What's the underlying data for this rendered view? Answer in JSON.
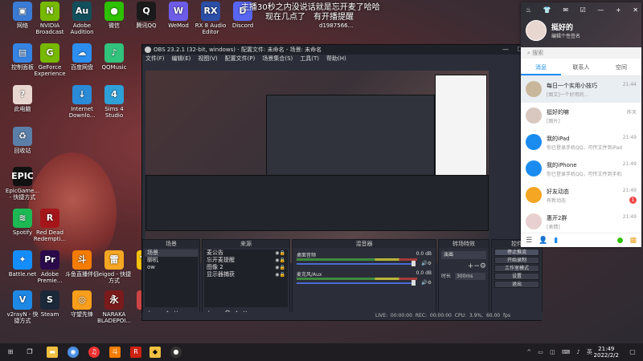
{
  "overlay": {
    "line1": "主播30秒之内没说话就是忘开麦了哈哈",
    "line2": "现在几点了",
    "line3": "有开播提醒",
    "line4": "d1987566..."
  },
  "desktop": [
    {
      "label": "网络",
      "icon": "network-icon",
      "color": "#3a7bd5",
      "glyph": "▣"
    },
    {
      "label": "NVIDIA Broadcast",
      "icon": "nvidia-icon",
      "color": "#76b900",
      "glyph": "N"
    },
    {
      "label": "Adobe Audition",
      "icon": "adobe-audition-icon",
      "color": "#124f5c",
      "glyph": "Au"
    },
    {
      "label": "微信",
      "icon": "wechat-icon",
      "color": "#2dc100",
      "glyph": "●"
    },
    {
      "label": "腾讯QQ",
      "icon": "qq-icon",
      "color": "#1a1a1a",
      "glyph": "Q"
    },
    {
      "label": "WeMod",
      "icon": "wemod-icon",
      "color": "#6c5ce7",
      "glyph": "W"
    },
    {
      "label": "RX 8 Audio Editor",
      "icon": "rx8-icon",
      "color": "#2b4fa8",
      "glyph": "RX"
    },
    {
      "label": "Discord",
      "icon": "discord-icon",
      "color": "#5865f2",
      "glyph": "D"
    },
    {
      "label": "控制面板",
      "icon": "control-panel-icon",
      "color": "#3584e4",
      "glyph": "▤"
    },
    {
      "label": "GeForce Experience",
      "icon": "geforce-icon",
      "color": "#76b900",
      "glyph": "G"
    },
    {
      "label": "百度网盘",
      "icon": "baidu-netdisk-icon",
      "color": "#2b8ef0",
      "glyph": "☁"
    },
    {
      "label": "QQMusic",
      "icon": "qqmusic-icon",
      "color": "#31c27c",
      "glyph": "♪"
    },
    {
      "label": "此电脑",
      "icon": "this-pc-icon",
      "color": "#e8d7d0",
      "glyph": "?"
    },
    {
      "label": "Internet Downlo...",
      "icon": "idm-icon",
      "color": "#2a8bd8",
      "glyph": "↓"
    },
    {
      "label": "Sims 4 Studio",
      "icon": "sims4-icon",
      "color": "#2ea0d8",
      "glyph": "4"
    },
    {
      "label": "回收站",
      "icon": "recycle-bin-icon",
      "color": "#5b7fa8",
      "glyph": "♻"
    },
    {
      "label": "EpicGame... - 快捷方式",
      "icon": "epic-games-icon",
      "color": "#111",
      "glyph": "EPIC"
    },
    {
      "label": "Spotify",
      "icon": "spotify-icon",
      "color": "#1db954",
      "glyph": "≋"
    },
    {
      "label": "Red Dead Redempti...",
      "icon": "rdr2-icon",
      "color": "#a4161a",
      "glyph": "R"
    },
    {
      "label": "Battle.net",
      "icon": "battlenet-icon",
      "color": "#148eff",
      "glyph": "✦"
    },
    {
      "label": "Adobe Premie...",
      "icon": "premiere-icon",
      "color": "#2a0a4a",
      "glyph": "Pr"
    },
    {
      "label": "斗鱼直播伴侣",
      "icon": "douyu-icon",
      "color": "#f57c00",
      "glyph": "斗"
    },
    {
      "label": "leigod - 快捷方式",
      "icon": "leigod-icon",
      "color": "#f5a623",
      "glyph": "雷"
    },
    {
      "label": "YY",
      "icon": "yy-icon",
      "color": "#f4c20d",
      "glyph": "YY"
    },
    {
      "label": "v2rayN - 快捷方式",
      "icon": "v2rayn-icon",
      "color": "#1e88e5",
      "glyph": "V"
    },
    {
      "label": "Steam",
      "icon": "steam-icon",
      "color": "#1b2838",
      "glyph": "S"
    },
    {
      "label": "守望先锋",
      "icon": "overwatch-icon",
      "color": "#f99e1a",
      "glyph": "◎"
    },
    {
      "label": "NARAKA BLADEPOI...",
      "icon": "naraka-icon",
      "color": "#7a1a1a",
      "glyph": "永"
    },
    {
      "label": "火...",
      "icon": "app-icon",
      "color": "#c44",
      "glyph": "火"
    }
  ],
  "obs": {
    "title": "OBS 23.2.1 (32-bit, windows) - 配置文件: 未命名 - 场景: 未命名",
    "menu": [
      "文件(F)",
      "编辑(E)",
      "视图(V)",
      "配置文件(P)",
      "场景集合(S)",
      "工具(T)",
      "帮助(H)"
    ],
    "docks": {
      "scenes": {
        "title": "场景",
        "items": [
          "场景",
          "聊机",
          "ow"
        ]
      },
      "sources": {
        "title": "来源",
        "items": [
          "麦公告",
          "忘开麦提醒",
          "图像 2",
          "显示器捕获"
        ]
      },
      "mixer": {
        "title": "混音器",
        "tracks": [
          {
            "name": "桌面音频",
            "db": "0.0 dB"
          },
          {
            "name": "麦克风/Aux",
            "db": "0.0 dB"
          }
        ]
      },
      "transitions": {
        "title": "转场特效",
        "type": "淡出",
        "duration_label": "时长",
        "duration": "300ms"
      },
      "controls": {
        "title": "控件",
        "buttons": [
          "停止推流",
          "开始录制",
          "工作室模式",
          "设置",
          "退出"
        ]
      }
    },
    "status": {
      "live": "LIVE: 00:00:00",
      "rec": "REC: 00:00:00",
      "cpu": "CPU: 3.9%, 60.00 fps"
    }
  },
  "qq": {
    "name": "挺好的",
    "signature": "编辑个性签名",
    "search_placeholder": "搜索",
    "tabs": [
      "消息",
      "联系人",
      "空间"
    ],
    "conversations": [
      {
        "title": "每日一个实用小技巧",
        "sub": "[图文]一个好用的...",
        "time": "21:44",
        "badge": "",
        "color": "#c9b79c"
      },
      {
        "title": "挺好的嘛",
        "sub": "[图片]",
        "time": "昨天",
        "badge": "",
        "color": "#d8c8c0"
      },
      {
        "title": "我的iPad",
        "sub": "你已登录手机QQ，可传文件到iPad",
        "time": "21:49",
        "badge": "",
        "color": "#1a8cf0"
      },
      {
        "title": "我的iPhone",
        "sub": "你已登录手机QQ，可传文件到手机",
        "time": "21:49",
        "badge": "",
        "color": "#1a8cf0"
      },
      {
        "title": "好友动态",
        "sub": "有新动态",
        "time": "21:49",
        "badge": "1",
        "color": "#f5a623"
      },
      {
        "title": "惠开2群",
        "sub": "[表情]",
        "time": "21:49",
        "badge": "",
        "color": "#e8d0d0"
      }
    ]
  },
  "taskbar": {
    "time": "21:49",
    "date": "2022/2/2"
  }
}
